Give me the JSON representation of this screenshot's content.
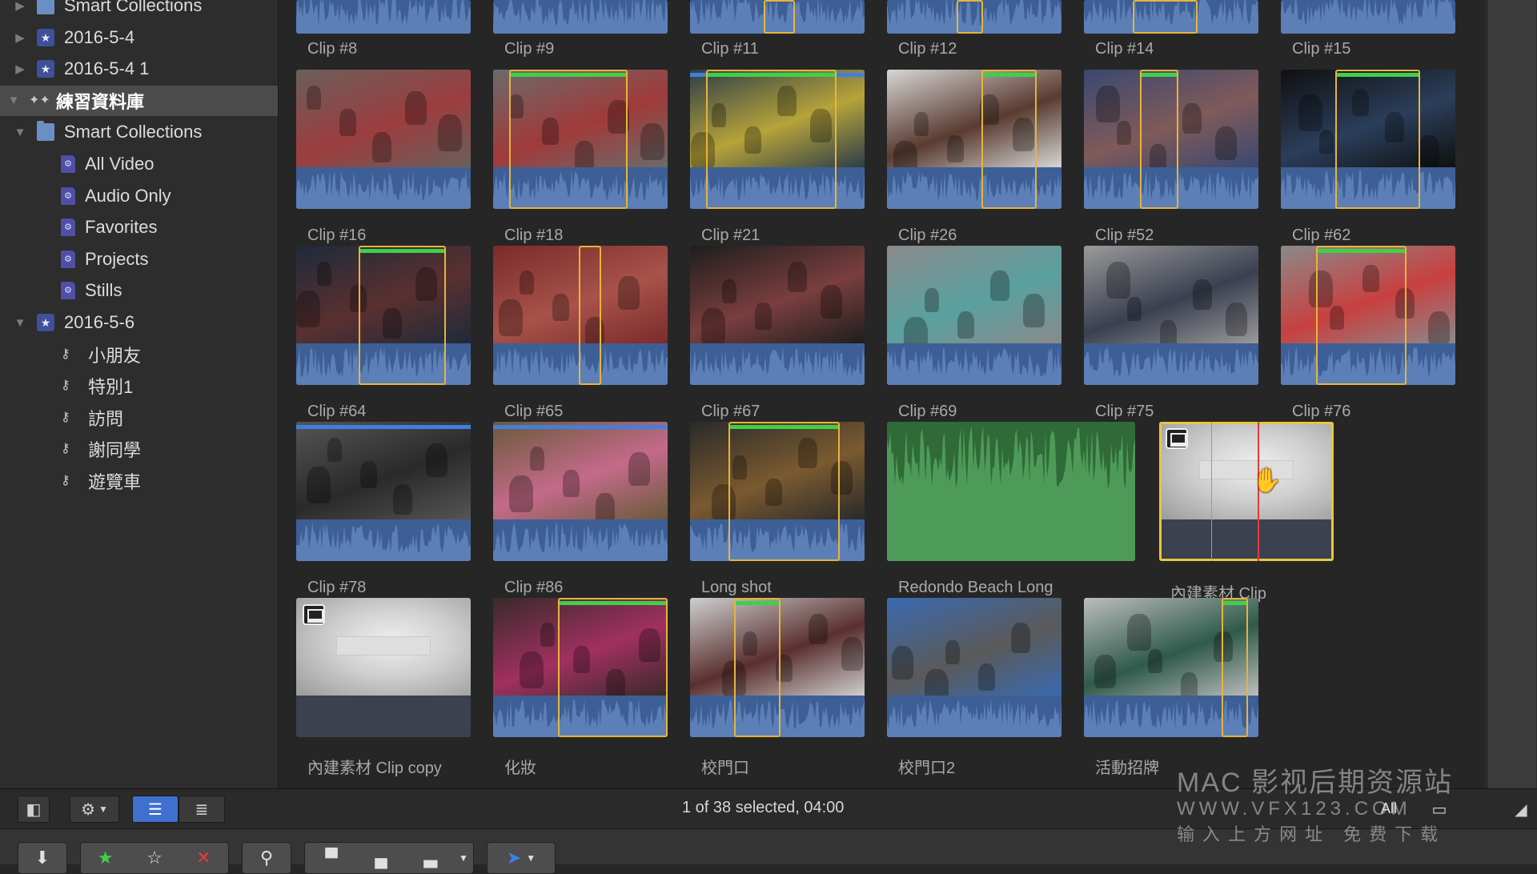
{
  "sidebar": {
    "items": [
      {
        "label": "Smart Collections",
        "icon": "folder-icon",
        "type": "folder",
        "indent": 1,
        "disclosure": "collapsed"
      },
      {
        "label": "2016-5-4",
        "icon": "event-star-icon",
        "type": "event",
        "indent": 1,
        "disclosure": "collapsed"
      },
      {
        "label": "2016-5-4 1",
        "icon": "event-star-icon",
        "type": "event",
        "indent": 1,
        "disclosure": "collapsed"
      },
      {
        "label": "練習資料庫",
        "icon": "library-icon",
        "type": "library",
        "indent": 0,
        "disclosure": "expanded",
        "selected": true
      },
      {
        "label": "Smart Collections",
        "icon": "folder-icon",
        "type": "folder",
        "indent": 1,
        "disclosure": "expanded"
      },
      {
        "label": "All Video",
        "icon": "smart-collection-icon",
        "type": "smart",
        "indent": 2
      },
      {
        "label": "Audio Only",
        "icon": "smart-collection-icon",
        "type": "smart",
        "indent": 2
      },
      {
        "label": "Favorites",
        "icon": "smart-collection-icon",
        "type": "smart",
        "indent": 2
      },
      {
        "label": "Projects",
        "icon": "smart-collection-icon",
        "type": "smart",
        "indent": 2
      },
      {
        "label": "Stills",
        "icon": "smart-collection-icon",
        "type": "smart",
        "indent": 2
      },
      {
        "label": "2016-5-6",
        "icon": "event-star-icon",
        "type": "event",
        "indent": 1,
        "disclosure": "expanded"
      },
      {
        "label": "小朋友",
        "icon": "keyword-collection-icon",
        "type": "keyword",
        "indent": 2
      },
      {
        "label": "特別1",
        "icon": "keyword-collection-icon",
        "type": "keyword",
        "indent": 2
      },
      {
        "label": "訪問",
        "icon": "keyword-collection-icon",
        "type": "keyword",
        "indent": 2
      },
      {
        "label": "謝同學",
        "icon": "keyword-collection-icon",
        "type": "keyword",
        "indent": 2
      },
      {
        "label": "遊覽車",
        "icon": "keyword-collection-icon",
        "type": "keyword",
        "indent": 2
      }
    ]
  },
  "browser": {
    "rows": [
      {
        "partial": true,
        "clips": [
          {
            "label": "Clip #8",
            "scene": [
              "#2b2b2b",
              "#4a4a4a"
            ]
          },
          {
            "label": "Clip #9",
            "scene": [
              "#3a3a3a",
              "#5a5a5a"
            ]
          },
          {
            "label": "Clip #11",
            "scene": [
              "#3a3a3a",
              "#5a5a5a"
            ],
            "range": [
              0.42,
              0.6
            ]
          },
          {
            "label": "Clip #12",
            "scene": [
              "#3a3a3a",
              "#5a5a5a"
            ],
            "range": [
              0.4,
              0.55
            ]
          },
          {
            "label": "Clip #14",
            "scene": [
              "#3a3a3a",
              "#5a5a5a"
            ],
            "range": [
              0.28,
              0.65
            ]
          },
          {
            "label": "Clip #15",
            "scene": [
              "#3a3a3a",
              "#5a5a5a"
            ]
          }
        ]
      },
      {
        "clips": [
          {
            "label": "Clip #16",
            "scene": [
              "#6a5f5a",
              "#9c3d3f"
            ]
          },
          {
            "label": "Clip #18",
            "scene": [
              "#6b6b6b",
              "#a03a3a"
            ],
            "range": [
              0.09,
              0.77
            ],
            "green": true
          },
          {
            "label": "Clip #21",
            "scene": [
              "#2d3d48",
              "#b6a33a"
            ],
            "range": [
              0.09,
              0.84
            ],
            "green": true,
            "blue": true
          },
          {
            "label": "Clip #26",
            "scene": [
              "#d6d6d6",
              "#5a3b30"
            ],
            "range": [
              0.54,
              0.86
            ],
            "green": true
          },
          {
            "label": "Clip #52",
            "scene": [
              "#3a4870",
              "#7f5a5a"
            ],
            "range": [
              0.32,
              0.54
            ],
            "green": true
          },
          {
            "label": "Clip #62",
            "scene": [
              "#101010",
              "#2b3e5a"
            ],
            "range": [
              0.31,
              0.8
            ],
            "green": true
          }
        ]
      },
      {
        "clips": [
          {
            "label": "Clip #64",
            "scene": [
              "#1e2a3a",
              "#5a3030"
            ],
            "range": [
              0.36,
              0.86
            ],
            "green": true
          },
          {
            "label": "Clip #65",
            "scene": [
              "#7a2b2b",
              "#a8524a"
            ],
            "range": [
              0.49,
              0.62
            ]
          },
          {
            "label": "Clip #67",
            "scene": [
              "#1e1e1e",
              "#7a3e3e"
            ]
          },
          {
            "label": "Clip #69",
            "scene": [
              "#8a8a8a",
              "#5aa0a0"
            ]
          },
          {
            "label": "Clip #75",
            "scene": [
              "#9a9a9a",
              "#3a4050"
            ]
          },
          {
            "label": "Clip #76",
            "scene": [
              "#8a8a8a",
              "#c84040"
            ],
            "range": [
              0.2,
              0.72
            ],
            "green": true
          }
        ]
      },
      {
        "clips": [
          {
            "label": "Clip #78",
            "scene": [
              "#555",
              "#2a2a2a"
            ],
            "blue": true
          },
          {
            "label": "Clip #86",
            "scene": [
              "#6a5a3a",
              "#c46a8a"
            ],
            "blue": true
          },
          {
            "label": "Long shot",
            "scene": [
              "#2a2a2a",
              "#7a5a30"
            ],
            "range": [
              0.22,
              0.86
            ],
            "green": true
          },
          {
            "label": "Redondo Beach Long",
            "audioOnly": true
          },
          {
            "label": "內建素材 Clip",
            "titleClip": true,
            "selected": true
          }
        ]
      },
      {
        "clips": [
          {
            "label": "內建素材 Clip copy",
            "titleClip": true
          },
          {
            "label": "化妝",
            "scene": [
              "#3a2a2a",
              "#a03060"
            ],
            "range": [
              0.37,
              1.0
            ],
            "green": true
          },
          {
            "label": "校門口",
            "scene": [
              "#cfcfcf",
              "#5a2f2f"
            ],
            "range": [
              0.25,
              0.52
            ],
            "green": true
          },
          {
            "label": "校門口2",
            "scene": [
              "#3a6ab0",
              "#5a5a5a"
            ]
          },
          {
            "label": "活動招牌",
            "scene": [
              "#bdbdbd",
              "#2f5a4a"
            ],
            "range": [
              0.79,
              0.94
            ],
            "green": true
          }
        ]
      }
    ]
  },
  "statusbar": {
    "status_text": "1 of 38 selected, 04:00",
    "filter_label": "All"
  },
  "watermark": {
    "line1": "MAC 影视后期资源站",
    "line2": "WWW.VFX123.COM",
    "line3": "输入上方网址 免费下载"
  },
  "colors": {
    "accent": "#3f6fcf",
    "range": "#e7b43a",
    "favorite": "#3fd04a",
    "playhead": "#e83a3a",
    "audio": "#3d5f96"
  }
}
